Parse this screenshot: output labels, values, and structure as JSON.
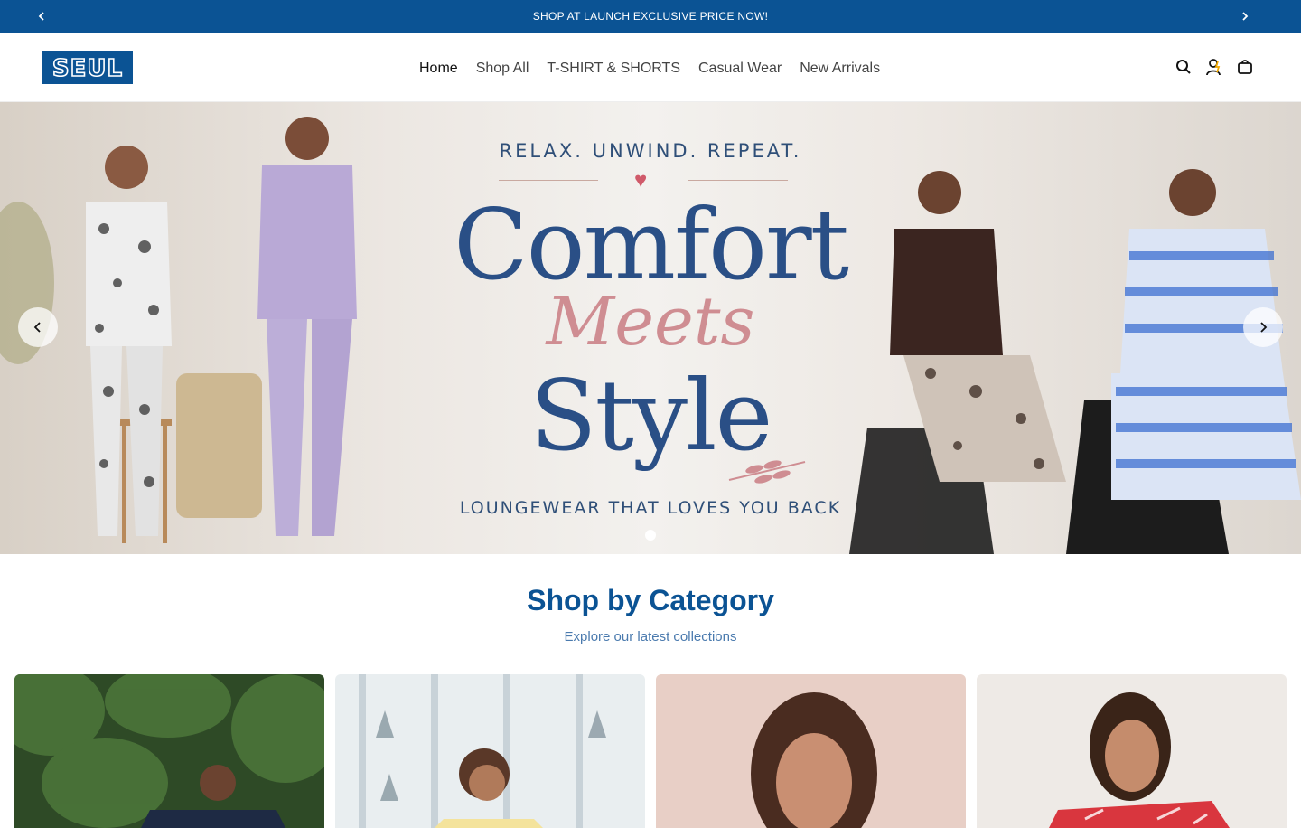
{
  "announcement": {
    "text": "SHOP AT LAUNCH EXCLUSIVE PRICE NOW!",
    "prev_icon": "chevron-left-icon",
    "next_icon": "chevron-right-icon"
  },
  "header": {
    "logo_text": "SEUL",
    "nav": [
      {
        "label": "Home",
        "active": true
      },
      {
        "label": "Shop All",
        "active": false
      },
      {
        "label": "T-SHIRT & SHORTS",
        "active": false
      },
      {
        "label": "Casual Wear",
        "active": false
      },
      {
        "label": "New Arrivals",
        "active": false
      }
    ],
    "icons": [
      "search-icon",
      "account-icon",
      "cart-icon"
    ]
  },
  "hero": {
    "kicker": "RELAX. UNWIND. REPEAT.",
    "headline_1": "Comfort",
    "headline_script": "Meets",
    "headline_2": "Style",
    "tagline": "LOUNGEWEAR THAT LOVES YOU BACK",
    "slide_count": 1,
    "current_slide": 1
  },
  "category_section": {
    "title": "Shop by Category",
    "subtitle": "Explore our latest collections",
    "cards": [
      "category-card-1",
      "category-card-2",
      "category-card-3",
      "category-card-4"
    ]
  },
  "colors": {
    "brand_blue": "#0b5394",
    "heading_blue": "#2a4f86",
    "script_pink": "#cf8d92"
  }
}
